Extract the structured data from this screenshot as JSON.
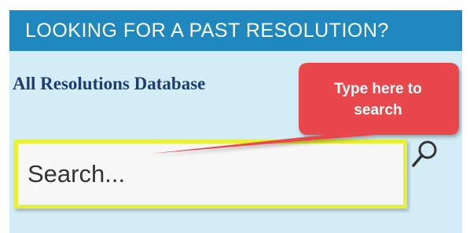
{
  "header": {
    "title": "LOOKING FOR A PAST RESOLUTION?"
  },
  "links": {
    "all_resolutions": "All Resolutions Database"
  },
  "search": {
    "placeholder": "Search...",
    "icon": "search-icon"
  },
  "callout": {
    "line1": "Type here to",
    "line2": "search",
    "color": "#e8474c"
  },
  "colors": {
    "header_bg": "#1e88bf",
    "panel_bg": "#d3ecf5",
    "highlight_border": "#e5f036",
    "link": "#1d3d74"
  }
}
